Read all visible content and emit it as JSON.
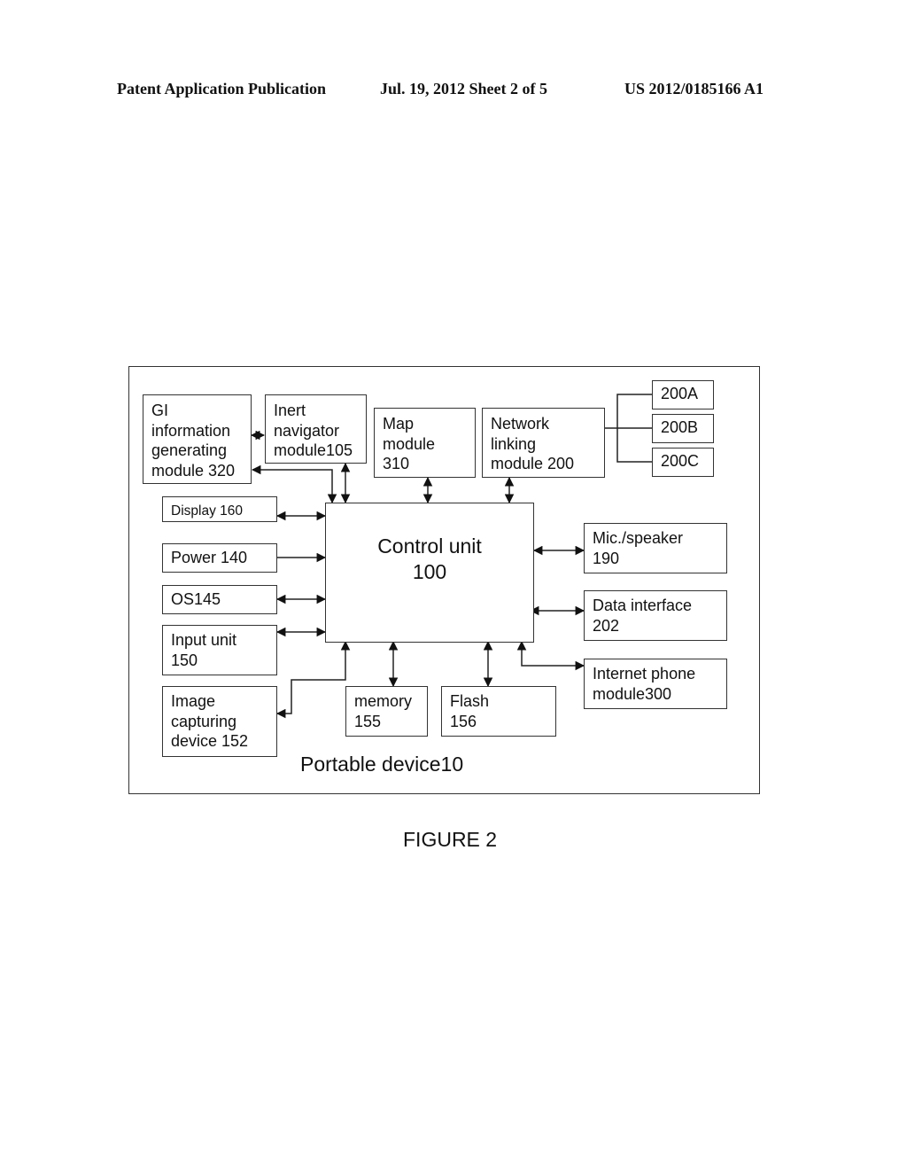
{
  "header": {
    "publication": "Patent Application Publication",
    "date_sheet": "Jul. 19, 2012   Sheet 2 of 5",
    "number": "US 2012/0185166 A1"
  },
  "diagram": {
    "container_label": "Portable device10",
    "figure_label": "FIGURE 2",
    "blocks": {
      "gi_module": "GI\ninformation\ngenerating\nmodule 320",
      "inert_navigator": "Inert\nnavigator\nmodule105",
      "map_module": "Map\nmodule\n310",
      "network_linking": "Network\nlinking\nmodule 200",
      "net_200a": "200A",
      "net_200b": "200B",
      "net_200c": "200C",
      "display": "Display 160",
      "power": "Power 140",
      "os": "OS145",
      "input_unit": "Input unit\n150",
      "image_capture": "Image\ncapturing\ndevice 152",
      "control_unit": "Control unit\n100",
      "memory": "memory\n155",
      "flash": "Flash\n156",
      "mic_speaker": "Mic./speaker\n190",
      "data_interface": "Data interface\n202",
      "internet_phone": "Internet phone\nmodule300"
    },
    "connections": [
      {
        "from": "gi_module",
        "to": "inert_navigator",
        "type": "bidirectional"
      },
      {
        "from": "control_unit",
        "to": "gi_module",
        "type": "bidirectional"
      },
      {
        "from": "inert_navigator",
        "to": "control_unit",
        "type": "bidirectional"
      },
      {
        "from": "map_module",
        "to": "control_unit",
        "type": "bidirectional"
      },
      {
        "from": "network_linking",
        "to": "control_unit",
        "type": "bidirectional"
      },
      {
        "from": "network_linking",
        "to": "net_200a",
        "type": "line"
      },
      {
        "from": "network_linking",
        "to": "net_200b",
        "type": "line"
      },
      {
        "from": "network_linking",
        "to": "net_200c",
        "type": "line"
      },
      {
        "from": "display",
        "to": "control_unit",
        "type": "bidirectional"
      },
      {
        "from": "power",
        "to": "control_unit",
        "type": "directed"
      },
      {
        "from": "os",
        "to": "control_unit",
        "type": "bidirectional"
      },
      {
        "from": "input_unit",
        "to": "control_unit",
        "type": "bidirectional"
      },
      {
        "from": "control_unit",
        "to": "image_capture",
        "type": "bidirectional"
      },
      {
        "from": "memory",
        "to": "control_unit",
        "type": "bidirectional"
      },
      {
        "from": "flash",
        "to": "control_unit",
        "type": "bidirectional"
      },
      {
        "from": "mic_speaker",
        "to": "control_unit",
        "type": "bidirectional"
      },
      {
        "from": "data_interface",
        "to": "control_unit",
        "type": "bidirectional"
      },
      {
        "from": "control_unit",
        "to": "internet_phone",
        "type": "bidirectional"
      }
    ]
  }
}
